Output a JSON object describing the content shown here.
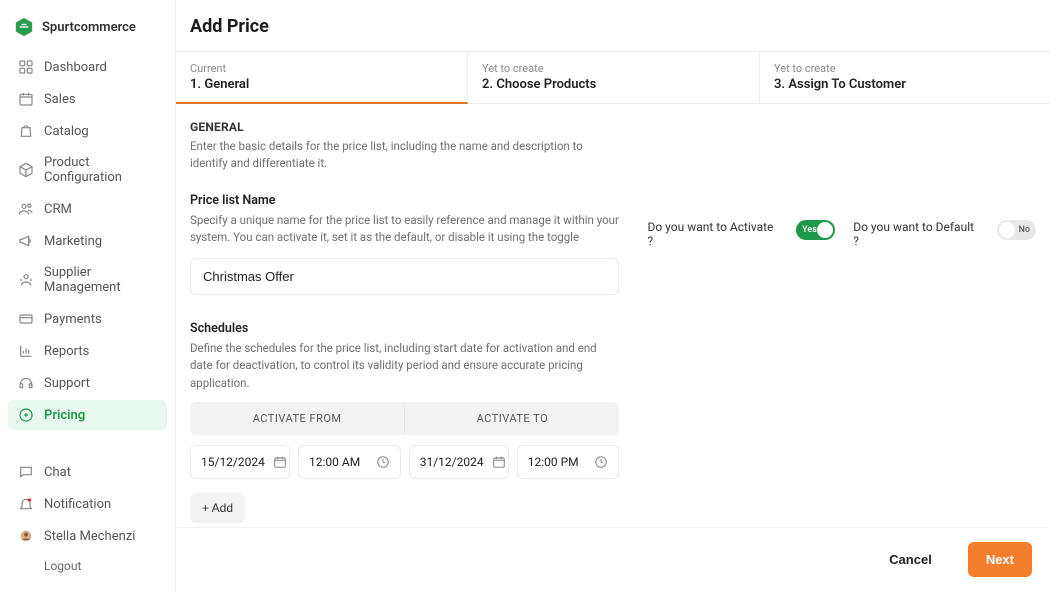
{
  "brand": {
    "name": "Spurtcommerce"
  },
  "sidebar": {
    "items": [
      {
        "label": "Dashboard",
        "icon": "grid-icon"
      },
      {
        "label": "Sales",
        "icon": "calendar-icon"
      },
      {
        "label": "Catalog",
        "icon": "bag-icon"
      },
      {
        "label": "Product Configuration",
        "icon": "package-icon"
      },
      {
        "label": "CRM",
        "icon": "users-icon"
      },
      {
        "label": "Marketing",
        "icon": "megaphone-icon"
      },
      {
        "label": "Supplier Management",
        "icon": "supplier-icon"
      },
      {
        "label": "Payments",
        "icon": "credit-card-icon"
      },
      {
        "label": "Reports",
        "icon": "chart-icon"
      },
      {
        "label": "Support",
        "icon": "headset-icon"
      },
      {
        "label": "Pricing",
        "icon": "pricing-icon"
      }
    ],
    "bottom": [
      {
        "label": "Chat",
        "icon": "chat-icon"
      },
      {
        "label": "Notification",
        "icon": "bell-icon"
      },
      {
        "label": "Stella Mechenzi",
        "icon": "avatar-icon"
      }
    ],
    "logout": "Logout",
    "active_index": 10
  },
  "page": {
    "title": "Add Price"
  },
  "steps": [
    {
      "status": "Current",
      "label": "1. General"
    },
    {
      "status": "Yet to create",
      "label": "2. Choose Products"
    },
    {
      "status": "Yet to create",
      "label": "3. Assign To Customer"
    }
  ],
  "general": {
    "heading": "GENERAL",
    "subtext": "Enter the basic details for the price list, including the name and description to identify and differentiate it.",
    "name": {
      "label": "Price list Name",
      "help": "Specify a unique name for the price list to easily reference and manage it within your system. You can activate it, set it as the default, or disable it using the toggle",
      "value": "Christmas Offer"
    },
    "activate": {
      "question": "Do you want to Activate ?",
      "on_label": "Yes"
    },
    "default": {
      "question": "Do you want to Default ?",
      "off_label": "No"
    }
  },
  "schedules": {
    "heading": "Schedules",
    "help": "Define the schedules for the price list, including start date for activation and end date for deactivation, to control its validity period and ensure accurate pricing application.",
    "col_from": "ACTIVATE FROM",
    "col_to": "ACTIVATE TO",
    "rows": [
      {
        "from_date": "15/12/2024",
        "from_time": "12:00  AM",
        "to_date": "31/12/2024",
        "to_time": "12:00  PM"
      }
    ],
    "add_label": "+ Add"
  },
  "footer": {
    "cancel": "Cancel",
    "next": "Next"
  }
}
